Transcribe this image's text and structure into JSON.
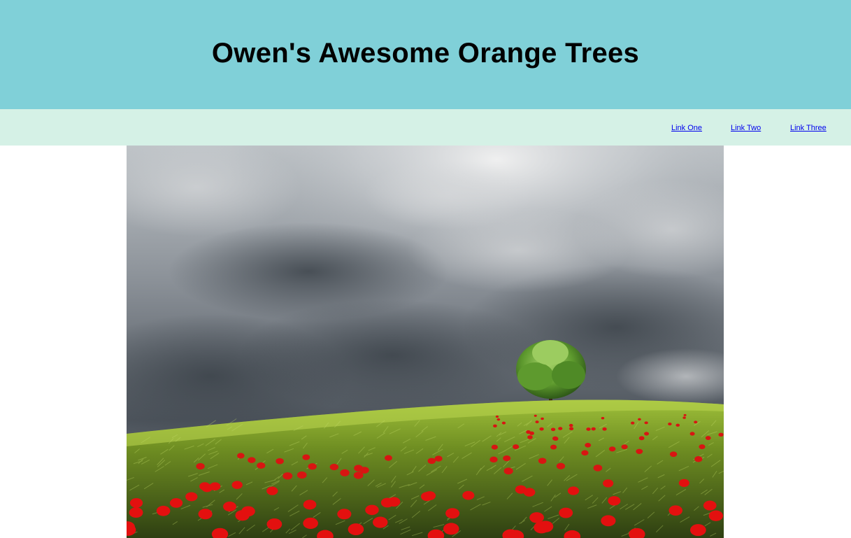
{
  "header": {
    "title": "Owen's Awesome Orange Trees"
  },
  "nav": {
    "links": [
      {
        "label": "Link One"
      },
      {
        "label": "Link Two"
      },
      {
        "label": "Link Three"
      }
    ]
  },
  "hero_image": {
    "subject": "lone tree on grassy hill with red poppies under stormy sky"
  },
  "colors": {
    "header_bg": "#80d0d8",
    "nav_bg": "#d5f1e6",
    "link": "#0000ee",
    "title": "#000000"
  }
}
